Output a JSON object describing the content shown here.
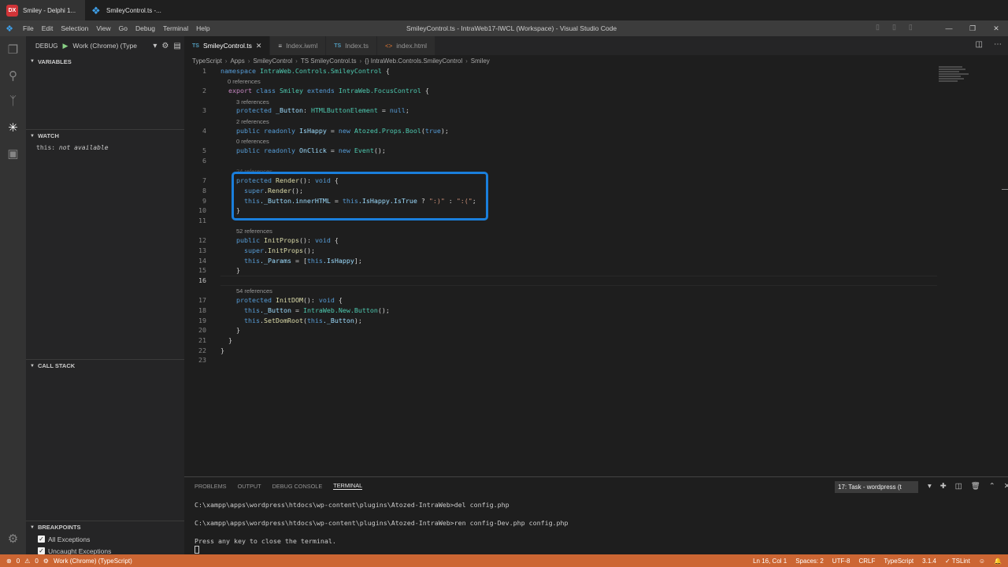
{
  "taskbar": {
    "items": [
      {
        "icon": "delphi-dx-icon",
        "badge": "DX",
        "label": "Smiley - Delphi 1..."
      },
      {
        "icon": "vscode-icon",
        "label": "SmileyControl.ts  -..."
      }
    ]
  },
  "titlebar": {
    "menu": [
      "File",
      "Edit",
      "Selection",
      "View",
      "Go",
      "Debug",
      "Terminal",
      "Help"
    ],
    "title": "SmileyControl.ts - IntraWeb17-IWCL (Workspace) - Visual Studio Code"
  },
  "activity": {
    "icons": [
      "explorer-icon",
      "search-icon",
      "source-control-icon",
      "debug-icon",
      "extensions-icon",
      "settings-gear-icon"
    ]
  },
  "sidebar": {
    "debug_label": "DEBUG",
    "config": "Work (Chrome) (Type",
    "variables_title": "VARIABLES",
    "watch_title": "WATCH",
    "watch": [
      {
        "name": "this",
        "value": "not available"
      }
    ],
    "callstack_title": "CALL STACK",
    "breakpoints_title": "BREAKPOINTS",
    "breakpoints": [
      "All Exceptions",
      "Uncaught Exceptions"
    ]
  },
  "tabs": [
    {
      "badge": "TS",
      "label": "SmileyControl.ts",
      "active": true
    },
    {
      "badge": "≡",
      "label": "Index.iwml",
      "active": false
    },
    {
      "badge": "TS",
      "label": "Index.ts",
      "active": false
    },
    {
      "badge": "<>",
      "label": "index.html",
      "active": false
    }
  ],
  "breadcrumb": [
    "TypeScript",
    "Apps",
    "SmileyControl",
    "TS SmileyControl.ts",
    "{} IntraWeb.Controls.SmileyControl",
    "Smiley"
  ],
  "editor": {
    "lens_refs": {
      "l2": "0 references",
      "l3": "3 references",
      "l4": "2 references",
      "l5": "0 references",
      "l7": "24 references",
      "l12": "52 references",
      "l17": "54 references"
    },
    "line_numbers": [
      "1",
      "2",
      "3",
      "4",
      "5",
      "6",
      "7",
      "8",
      "9",
      "10",
      "11",
      "12",
      "13",
      "14",
      "15",
      "16",
      "17",
      "18",
      "19",
      "20",
      "21",
      "22",
      "23"
    ],
    "code": {
      "l1a": "namespace",
      "l1b": "IntraWeb.Controls.SmileyControl",
      "l1c": " {",
      "l2a": "export",
      "l2b": "class",
      "l2c": "Smiley",
      "l2d": "extends",
      "l2e": "IntraWeb.FocusControl",
      "l2f": " {",
      "l3a": "protected",
      "l3b": "_Button",
      "l3c": ": ",
      "l3d": "HTMLButtonElement",
      "l3e": " = ",
      "l3f": "null",
      "l3g": ";",
      "l4a": "public",
      "l4b": "readonly",
      "l4c": "IsHappy",
      "l4d": " = ",
      "l4e": "new",
      "l4f": "Atozed.Props.Bool",
      "l4g": "(",
      "l4h": "true",
      "l4i": ");",
      "l5a": "public",
      "l5b": "readonly",
      "l5c": "OnClick",
      "l5d": " = ",
      "l5e": "new",
      "l5f": "Event",
      "l5g": "();",
      "l7a": "protected",
      "l7b": "Render",
      "l7c": "(): ",
      "l7d": "void",
      "l7e": " {",
      "l8a": "super",
      "l8b": ".",
      "l8c": "Render",
      "l8d": "();",
      "l9a": "this",
      "l9b": "._Button.innerHTML",
      "l9c": " = ",
      "l9d": "this",
      "l9e": ".IsHappy.IsTrue",
      "l9f": " ? ",
      "l9g": "\":)\"",
      "l9h": " : ",
      "l9i": "\":(\"",
      "l9j": ";",
      "l10": "}",
      "l12a": "public",
      "l12b": "InitProps",
      "l12c": "(): ",
      "l12d": "void",
      "l12e": " {",
      "l13a": "super",
      "l13b": ".",
      "l13c": "InitProps",
      "l13d": "();",
      "l14a": "this",
      "l14b": "._Params",
      "l14c": " = [",
      "l14d": "this",
      "l14e": ".IsHappy",
      "l14f": "];",
      "l15": "}",
      "l17a": "protected",
      "l17b": "InitDOM",
      "l17c": "(): ",
      "l17d": "void",
      "l17e": " {",
      "l18a": "this",
      "l18b": "._Button",
      "l18c": " = ",
      "l18d": "IntraWeb.New.Button",
      "l18e": "();",
      "l19a": "this",
      "l19b": ".",
      "l19c": "SetDomRoot",
      "l19d": "(",
      "l19e": "this",
      "l19f": "._Button",
      "l19g": ");",
      "l20": "}",
      "l21": "}",
      "l22": "}"
    }
  },
  "panel": {
    "tabs": [
      "PROBLEMS",
      "OUTPUT",
      "DEBUG CONSOLE",
      "TERMINAL"
    ],
    "active_tab": "TERMINAL",
    "terminal_select": "17: Task - wordpress (t",
    "lines": [
      "C:\\xampp\\apps\\wordpress\\htdocs\\wp-content\\plugins\\Atozed-IntraWeb>del config.php",
      "C:\\xampp\\apps\\wordpress\\htdocs\\wp-content\\plugins\\Atozed-IntraWeb>ren config-Dev.php config.php",
      "Press any key to close the terminal."
    ]
  },
  "statusbar": {
    "errors": "0",
    "warnings": "0",
    "debug_config": "Work (Chrome) (TypeScript)",
    "position": "Ln 16, Col 1",
    "spaces": "Spaces: 2",
    "encoding": "UTF-8",
    "eol": "CRLF",
    "language": "TypeScript",
    "version": "3.1.4",
    "linter": "TSLint"
  },
  "colors": {
    "statusbar": "#cc6633",
    "highlight_box": "#1a7fdc",
    "activitybar": "#333333",
    "sidebar": "#252526",
    "editor": "#1e1e1e"
  }
}
